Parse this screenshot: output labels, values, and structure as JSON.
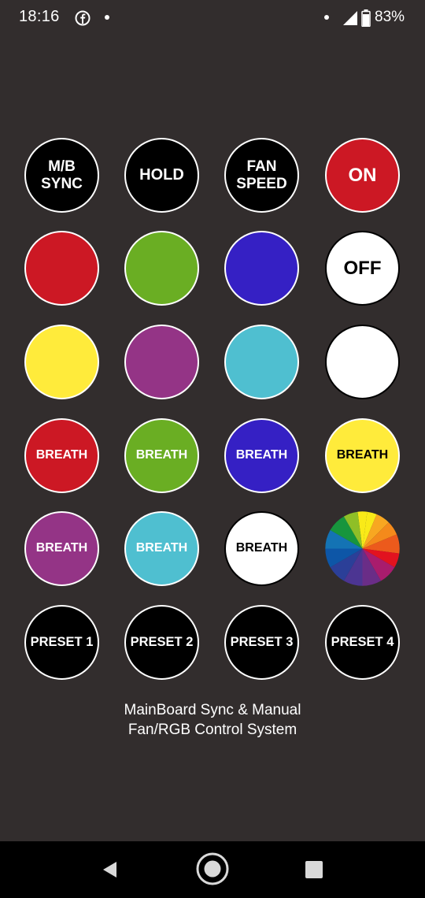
{
  "status_bar": {
    "time": "18:16",
    "battery": "83%",
    "icons": [
      "facebook-icon",
      "notification-dot",
      "notification-dot",
      "cell-signal-icon",
      "battery-icon"
    ]
  },
  "colors": {
    "background": "#322d2d",
    "red": "#cc1824",
    "green": "#6aae23",
    "blue": "#3520c4",
    "yellow": "#ffeb3b",
    "purple": "#943486",
    "cyan": "#4fbfd0",
    "white": "#ffffff",
    "black": "#000000"
  },
  "buttons": {
    "mb_sync": "M/B\nSYNC",
    "hold": "HOLD",
    "fan_speed": "FAN\nSPEED",
    "on": "ON",
    "off": "OFF",
    "breath_red": "BREATH",
    "breath_green": "BREATH",
    "breath_blue": "BREATH",
    "breath_yellow": "BREATH",
    "breath_purple": "BREATH",
    "breath_cyan": "BREATH",
    "breath_white": "BREATH",
    "preset1": "PRESET 1",
    "preset2": "PRESET 2",
    "preset3": "PRESET 3",
    "preset4": "PRESET 4"
  },
  "swatches": {
    "red": "red",
    "green": "green",
    "blue": "blue",
    "yellow": "yellow",
    "purple": "purple",
    "cyan": "cyan",
    "white": "white"
  },
  "footer": {
    "line1": "MainBoard Sync & Manual",
    "line2": "Fan/RGB Control System"
  },
  "nav": {
    "icons": [
      "back-icon",
      "home-icon",
      "recent-apps-icon"
    ]
  }
}
